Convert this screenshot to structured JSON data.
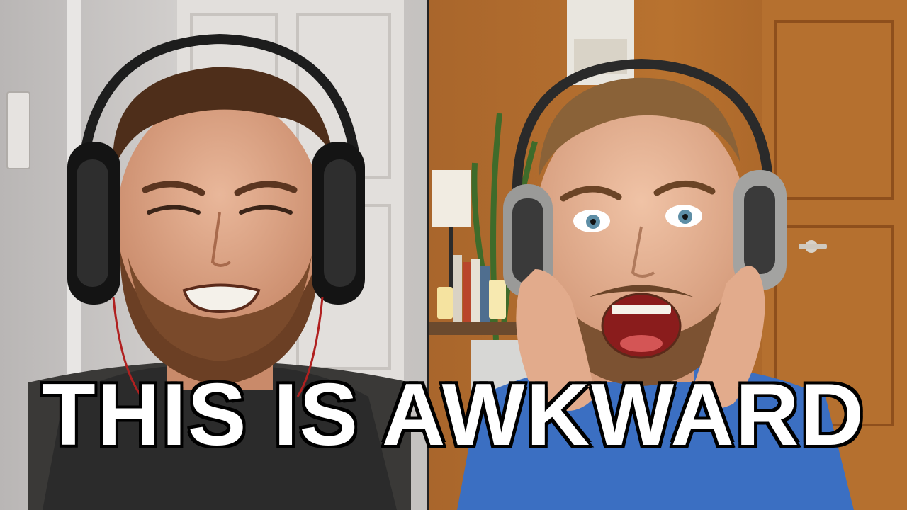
{
  "caption": "THIS IS AWKWARD",
  "colors": {
    "caption_text": "#ffffff",
    "caption_outline": "#000000",
    "left_wall": "#c9c6c4",
    "right_wall_wood": "#b06a2a",
    "right_shirt": "#3b6fc2",
    "left_shirt": "#2b2b2b"
  },
  "scene": {
    "left_panel": "person-left-headphones-grimace",
    "right_panel": "person-right-headphones-excited"
  }
}
